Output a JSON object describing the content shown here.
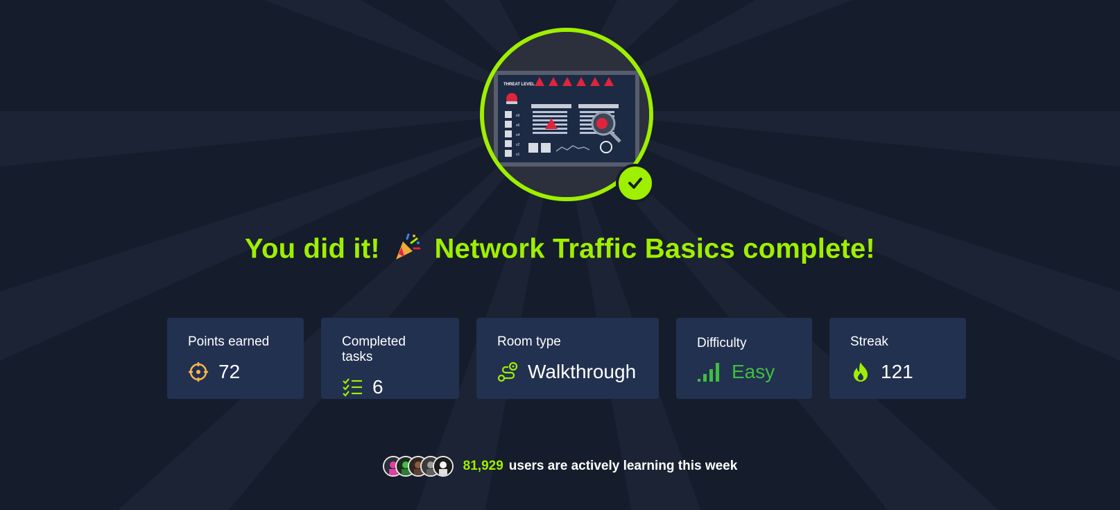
{
  "hero": {
    "image_icon": "network-traffic-room-illustration",
    "badge_icon": "check-icon"
  },
  "headline": {
    "prefix": "You did it!",
    "emoji": "🎉",
    "suffix": "Network Traffic Basics complete!"
  },
  "stats": [
    {
      "label": "Points earned",
      "value": "72",
      "icon": "target-icon"
    },
    {
      "label": "Completed tasks",
      "value": "6",
      "icon": "checklist-icon"
    },
    {
      "label": "Room type",
      "value": "Walkthrough",
      "icon": "route-icon"
    },
    {
      "label": "Difficulty",
      "value": "Easy",
      "icon": "signal-bars-icon"
    },
    {
      "label": "Streak",
      "value": "121",
      "icon": "flame-icon"
    }
  ],
  "footer": {
    "count": "81,929",
    "text": "users are actively learning this week"
  },
  "colors": {
    "background": "#151c2b",
    "card": "#223150",
    "accent": "#9fef00",
    "easy": "#3fbf3f",
    "points": "#ffb74d"
  }
}
